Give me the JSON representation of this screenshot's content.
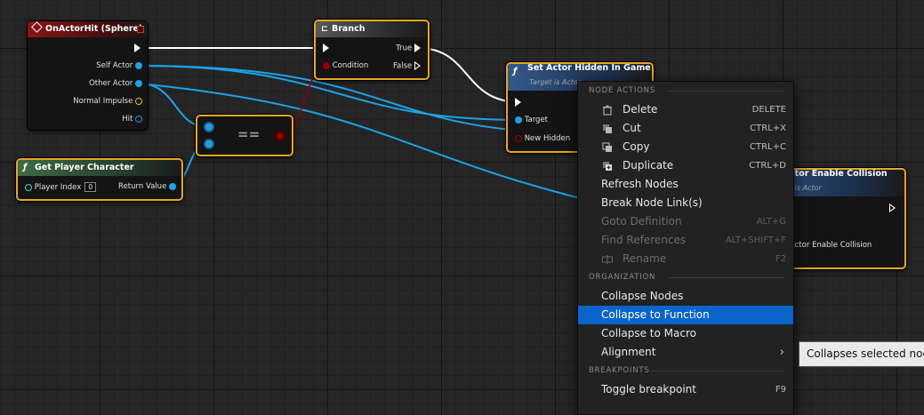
{
  "nodes": {
    "on_actor_hit": {
      "title": "OnActorHit (Sphere)",
      "pins": [
        "Self Actor",
        "Other Actor",
        "Normal Impulse",
        "Hit"
      ]
    },
    "branch": {
      "title": "Branch",
      "pins": [
        "Condition",
        "True",
        "False"
      ]
    },
    "equal": {
      "title": "=="
    },
    "get_player_character": {
      "title": "Get Player Character",
      "pins": [
        "Player Index",
        "Return Value"
      ],
      "player_index_value": "0"
    },
    "set_actor_hidden": {
      "title": "Set Actor Hidden In Game",
      "subtitle": "Target is Actor",
      "pins": [
        "Target",
        "New Hidden"
      ]
    },
    "set_actor_collision": {
      "title": "ctor Enable Collision",
      "subtitle": "t is Actor",
      "pins": [
        "t",
        "Actor Enable Collision"
      ]
    }
  },
  "context_menu": {
    "sections": {
      "node_actions": "NODE ACTIONS",
      "organization": "ORGANIZATION",
      "breakpoints": "BREAKPOINTS"
    },
    "items": [
      {
        "label": "Delete",
        "shortcut": "DELETE",
        "icon": "trash-icon"
      },
      {
        "label": "Cut",
        "shortcut": "CTRL+X",
        "icon": "cut-icon"
      },
      {
        "label": "Copy",
        "shortcut": "CTRL+C",
        "icon": "copy-icon"
      },
      {
        "label": "Duplicate",
        "shortcut": "CTRL+D",
        "icon": "duplicate-icon"
      },
      {
        "label": "Refresh Nodes",
        "shortcut": ""
      },
      {
        "label": "Break Node Link(s)",
        "shortcut": ""
      },
      {
        "label": "Goto Definition",
        "shortcut": "ALT+G",
        "disabled": true
      },
      {
        "label": "Find References",
        "shortcut": "ALT+SHIFT+F",
        "disabled": true
      },
      {
        "label": "Rename",
        "shortcut": "F2",
        "disabled": true,
        "icon": "rename-icon"
      },
      {
        "label": "Collapse Nodes",
        "shortcut": ""
      },
      {
        "label": "Collapse to Function",
        "shortcut": "",
        "highlighted": true
      },
      {
        "label": "Collapse to Macro",
        "shortcut": ""
      },
      {
        "label": "Alignment",
        "shortcut": "",
        "submenu": true
      },
      {
        "label": "Toggle breakpoint",
        "shortcut": "F9"
      }
    ]
  },
  "tooltip": "Collapses selected nodes",
  "colors": {
    "exec_wire": "#ffffff",
    "object_wire": "#1ba3e8",
    "bool_wire": "#960000",
    "selection": "#e8a61c",
    "menu_highlight": "#0a64cc"
  }
}
